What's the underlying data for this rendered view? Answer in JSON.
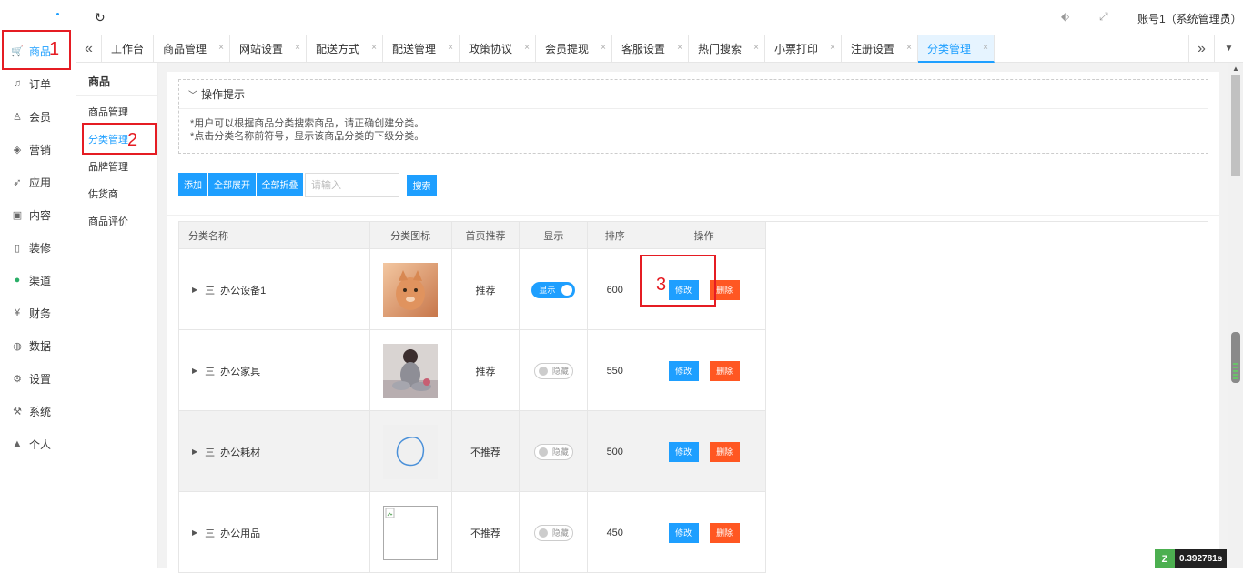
{
  "sidebar": {
    "items": [
      {
        "label": "商品",
        "icon": "cart-icon",
        "glyph": "🛒"
      },
      {
        "label": "订单",
        "icon": "bell-icon",
        "glyph": "♫"
      },
      {
        "label": "会员",
        "icon": "user-icon",
        "glyph": "♙"
      },
      {
        "label": "营销",
        "icon": "cube-icon",
        "glyph": "◈"
      },
      {
        "label": "应用",
        "icon": "send-icon",
        "glyph": "➶"
      },
      {
        "label": "内容",
        "icon": "bus-icon",
        "glyph": "▣"
      },
      {
        "label": "装修",
        "icon": "phone-icon",
        "glyph": "▯"
      },
      {
        "label": "渠道",
        "icon": "wechat-icon",
        "glyph": "●"
      },
      {
        "label": "财务",
        "icon": "yen-icon",
        "glyph": "¥"
      },
      {
        "label": "数据",
        "icon": "globe-icon",
        "glyph": "◍"
      },
      {
        "label": "设置",
        "icon": "gear-icon",
        "glyph": "⚙"
      },
      {
        "label": "系统",
        "icon": "tools-icon",
        "glyph": "⚒"
      },
      {
        "label": "个人",
        "icon": "person-icon",
        "glyph": "▲"
      }
    ]
  },
  "header": {
    "refresh_glyph": "↻",
    "tag_glyph": "⬖",
    "fullscreen_glyph": "⤢",
    "account": "账号1（系统管理员）",
    "caret": "▾"
  },
  "tabs": {
    "prev_glyph": "«",
    "next_glyph": "»",
    "menu_glyph": "▼",
    "close_glyph": "×",
    "items": [
      {
        "label": "工作台"
      },
      {
        "label": "商品管理"
      },
      {
        "label": "网站设置"
      },
      {
        "label": "配送方式"
      },
      {
        "label": "配送管理"
      },
      {
        "label": "政策协议"
      },
      {
        "label": "会员提现"
      },
      {
        "label": "客服设置"
      },
      {
        "label": "热门搜索"
      },
      {
        "label": "小票打印"
      },
      {
        "label": "注册设置"
      },
      {
        "label": "分类管理"
      }
    ]
  },
  "submenu": {
    "title": "商品",
    "items": [
      {
        "label": "商品管理"
      },
      {
        "label": "分类管理"
      },
      {
        "label": "品牌管理"
      },
      {
        "label": "供货商"
      },
      {
        "label": "商品评价"
      }
    ]
  },
  "tips": {
    "chevron": "﹀",
    "title": "操作提示",
    "line1": "*用户可以根据商品分类搜索商品，请正确创建分类。",
    "line2": "*点击分类名称前符号，显示该商品分类的下级分类。"
  },
  "toolbar": {
    "add": "添加",
    "expand_all": "全部展开",
    "collapse_all": "全部折叠",
    "search_placeholder": "请输入",
    "search": "搜索"
  },
  "table": {
    "headers": [
      "分类名称",
      "分类图标",
      "首页推荐",
      "显示",
      "排序",
      "操作"
    ],
    "arrow_glyph": "▶",
    "menu_glyph": "三",
    "edit_label": "修改",
    "delete_label": "删除",
    "rows": [
      {
        "name": "办公设备1",
        "recommend": "推荐",
        "display": "显示",
        "display_on": true,
        "sort": "600"
      },
      {
        "name": "办公家具",
        "recommend": "推荐",
        "display": "隐藏",
        "display_on": false,
        "sort": "550"
      },
      {
        "name": "办公耗材",
        "recommend": "不推荐",
        "display": "隐藏",
        "display_on": false,
        "sort": "500"
      },
      {
        "name": "办公用品",
        "recommend": "不推荐",
        "display": "隐藏",
        "display_on": false,
        "sort": "450"
      }
    ]
  },
  "annotations": [
    "1",
    "2",
    "3"
  ],
  "timer": {
    "logo": "Z",
    "value": "0.392781s"
  },
  "colors": {
    "accent": "#1e9fff",
    "danger": "#ff5722",
    "annotation": "#e51c23"
  }
}
